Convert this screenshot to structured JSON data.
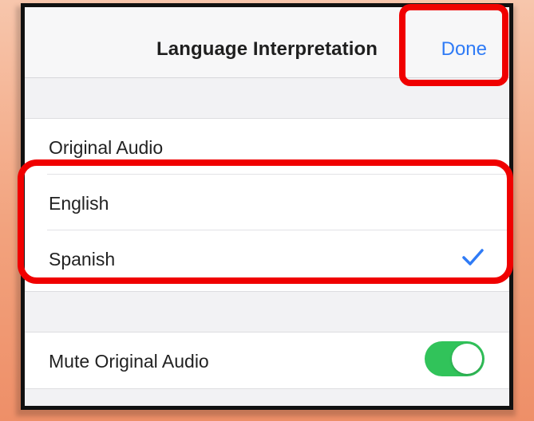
{
  "header": {
    "title": "Language Interpretation",
    "done_label": "Done"
  },
  "options": [
    {
      "label": "Original Audio",
      "selected": false
    },
    {
      "label": "English",
      "selected": false
    },
    {
      "label": "Spanish",
      "selected": true
    }
  ],
  "mute": {
    "label": "Mute Original Audio",
    "enabled": true
  },
  "colors": {
    "accent": "#2f7bf6",
    "toggle_on": "#31c35a",
    "highlight": "#f00000"
  },
  "icons": {
    "check": "checkmark-icon"
  }
}
